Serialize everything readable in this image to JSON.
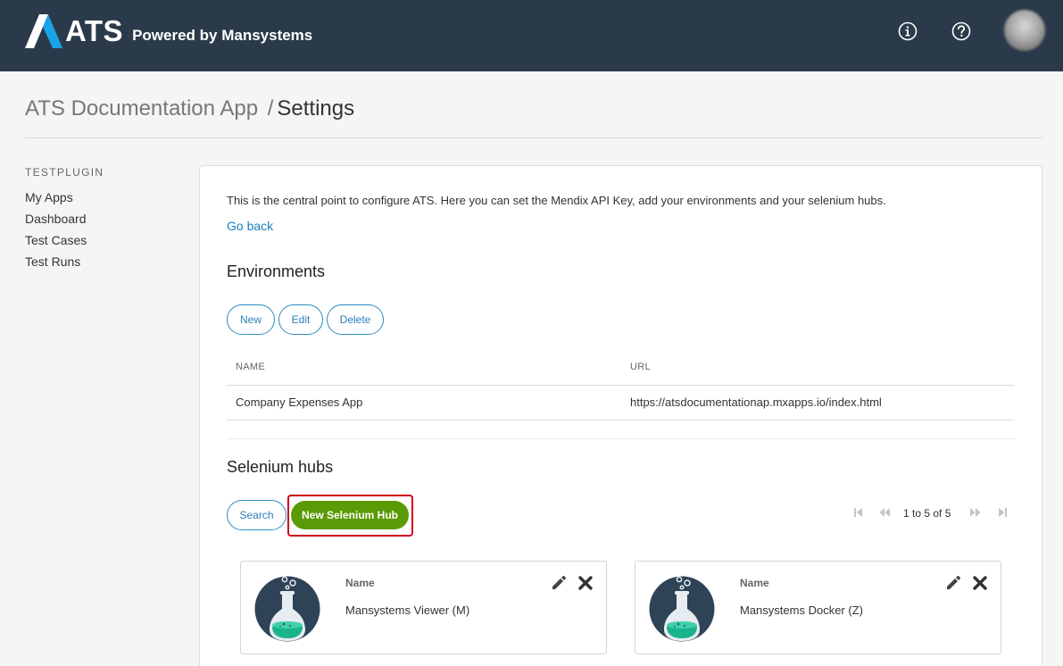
{
  "header": {
    "logo_text": "ATS",
    "logo_subtext": "Powered by Mansystems",
    "icons": [
      "info-icon",
      "help-icon"
    ],
    "colors": {
      "bar": "#2b3a4a",
      "logo_accent": "#1aa3e8"
    }
  },
  "breadcrumb": {
    "app": "ATS Documentation App",
    "separator": "/",
    "page": "Settings"
  },
  "sidebar": {
    "heading": "TESTPLUGIN",
    "items": [
      {
        "label": "My Apps"
      },
      {
        "label": "Dashboard"
      },
      {
        "label": "Test Cases"
      },
      {
        "label": "Test Runs"
      }
    ]
  },
  "main": {
    "intro": "This is the central point to configure ATS. Here you can set the Mendix API Key, add your environments and your selenium hubs.",
    "go_back": "Go back",
    "environments": {
      "title": "Environments",
      "buttons": {
        "new": "New",
        "edit": "Edit",
        "delete": "Delete"
      },
      "columns": [
        "NAME",
        "URL"
      ],
      "rows": [
        {
          "name": "Company Expenses App",
          "url": "https://atsdocumentationap.mxapps.io/index.html"
        }
      ]
    },
    "selenium_hubs": {
      "title": "Selenium hubs",
      "search_label": "Search",
      "new_hub_label": "New Selenium Hub",
      "pager_text": "1 to 5 of 5",
      "accent": "#5a9a07",
      "hubs": [
        {
          "name_label": "Name",
          "name": "Mansystems Viewer (M)"
        },
        {
          "name_label": "Name",
          "name": "Mansystems Docker (Z)"
        }
      ]
    }
  }
}
